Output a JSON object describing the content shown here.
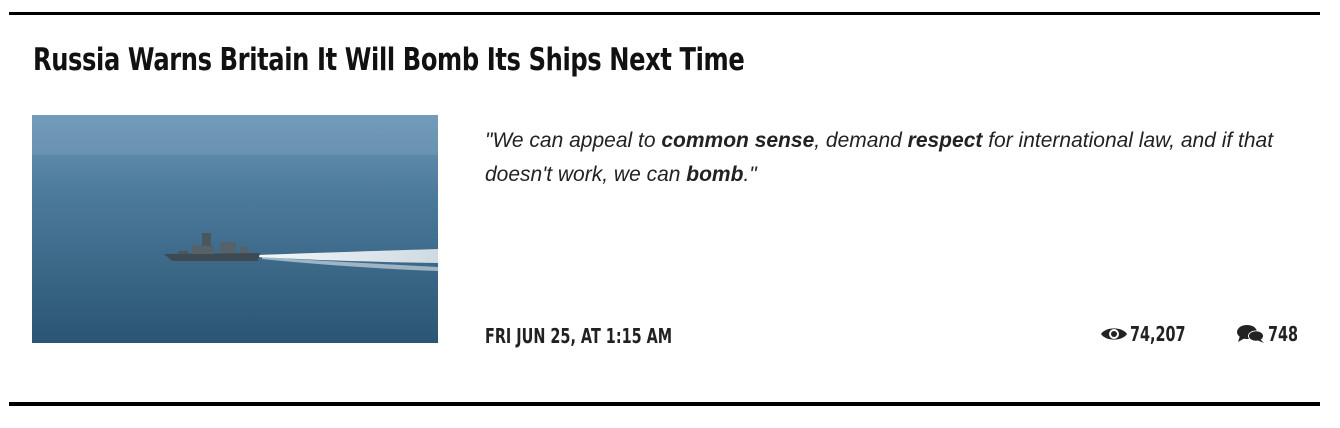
{
  "article": {
    "title": "Russia Warns Britain It Will Bomb Its Ships Next Time",
    "quote": {
      "open": "\"We can appeal to ",
      "b1": "common sense",
      "mid1": ", demand ",
      "b2": "respect",
      "mid2": " for international law, and if that doesn't work, we can ",
      "b3": "bomb",
      "close": ".\""
    },
    "date": "FRI JUN 25, AT 1:15 AM",
    "views": "74,207",
    "comments": "748",
    "icons": {
      "views": "eye-icon",
      "comments": "speech-bubbles-icon"
    },
    "colors": {
      "rule": "#000000",
      "text": "#111111",
      "sea_top": "#6f9ab8",
      "sea_bottom": "#2a5774"
    }
  }
}
